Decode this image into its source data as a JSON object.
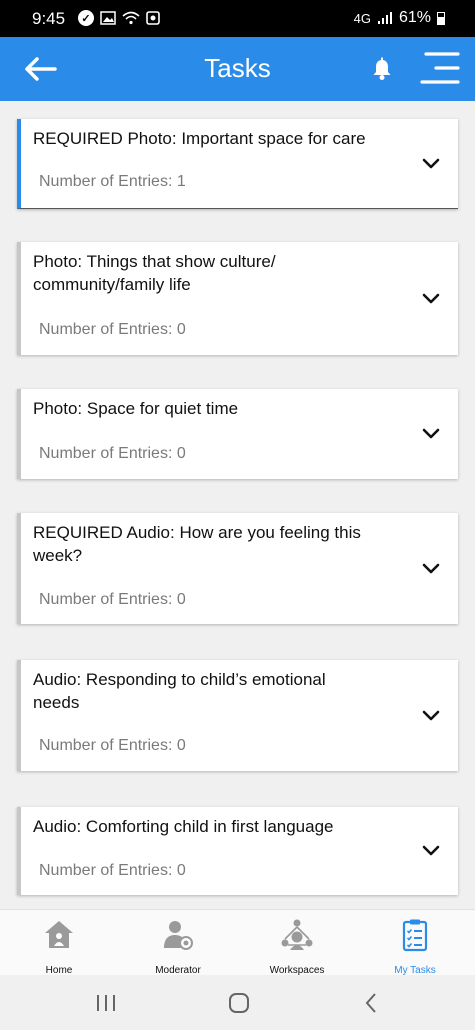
{
  "status_bar": {
    "time": "9:45",
    "network": "4G",
    "battery": "61%"
  },
  "header": {
    "title": "Tasks"
  },
  "tasks": [
    {
      "title": "REQUIRED Photo: Important space for care",
      "entries": "Number of Entries: 1",
      "active": true
    },
    {
      "title": "Photo: Things that show culture/ community/family life",
      "entries": "Number of Entries: 0",
      "active": false
    },
    {
      "title": "Photo: Space for quiet time",
      "entries": "Number of Entries: 0",
      "active": false
    },
    {
      "title": "REQUIRED Audio: How are you feeling this week?",
      "entries": "Number of Entries: 0",
      "active": false
    },
    {
      "title": "Audio: Responding to child’s emotional needs",
      "entries": "Number of Entries: 0",
      "active": false
    },
    {
      "title": "Audio: Comforting child in first language",
      "entries": "Number of Entries: 0",
      "active": false
    }
  ],
  "bottom_nav": [
    {
      "label": "Home",
      "icon": "home-icon",
      "active": false
    },
    {
      "label": "Moderator",
      "icon": "moderator-icon",
      "active": false
    },
    {
      "label": "Workspaces",
      "icon": "workspaces-icon",
      "active": false
    },
    {
      "label": "My Tasks",
      "icon": "clipboard-checklist-icon",
      "active": true
    }
  ],
  "colors": {
    "primary": "#2b8be8",
    "inactive_border": "#c7c7c7",
    "muted_text": "#7a7a7a",
    "nav_icon_gray": "#9a9a9a"
  }
}
